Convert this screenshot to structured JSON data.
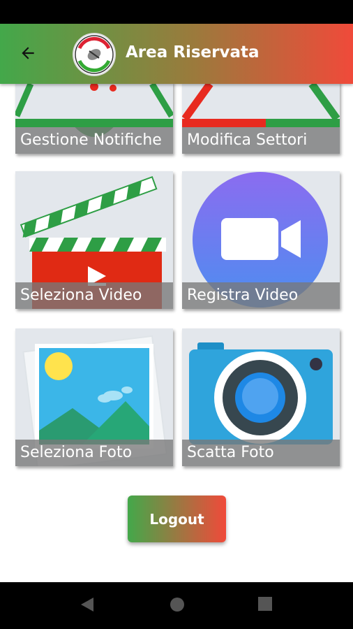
{
  "header": {
    "title": "Area Riservata",
    "back_icon": "arrow-left-icon",
    "logo_text": "RUGBY SEGNI",
    "logo_subtext": "A.S.D."
  },
  "tiles": [
    {
      "label": "Gestione Notifiche",
      "icon": "notification-icon"
    },
    {
      "label": "Modifica Settori",
      "icon": "sectors-icon"
    },
    {
      "label": "Seleziona Video",
      "icon": "clapperboard-icon"
    },
    {
      "label": "Registra Video",
      "icon": "video-camera-icon"
    },
    {
      "label": "Seleziona Foto",
      "icon": "gallery-icon"
    },
    {
      "label": "Scatta Foto",
      "icon": "camera-icon"
    }
  ],
  "logout": {
    "label": "Logout"
  },
  "nav": {
    "back": "nav-back-icon",
    "home": "nav-home-icon",
    "recents": "nav-recents-icon"
  },
  "colors": {
    "green": "#43a84a",
    "red": "#f04a3a",
    "tile_bg": "#e3e7ec"
  }
}
